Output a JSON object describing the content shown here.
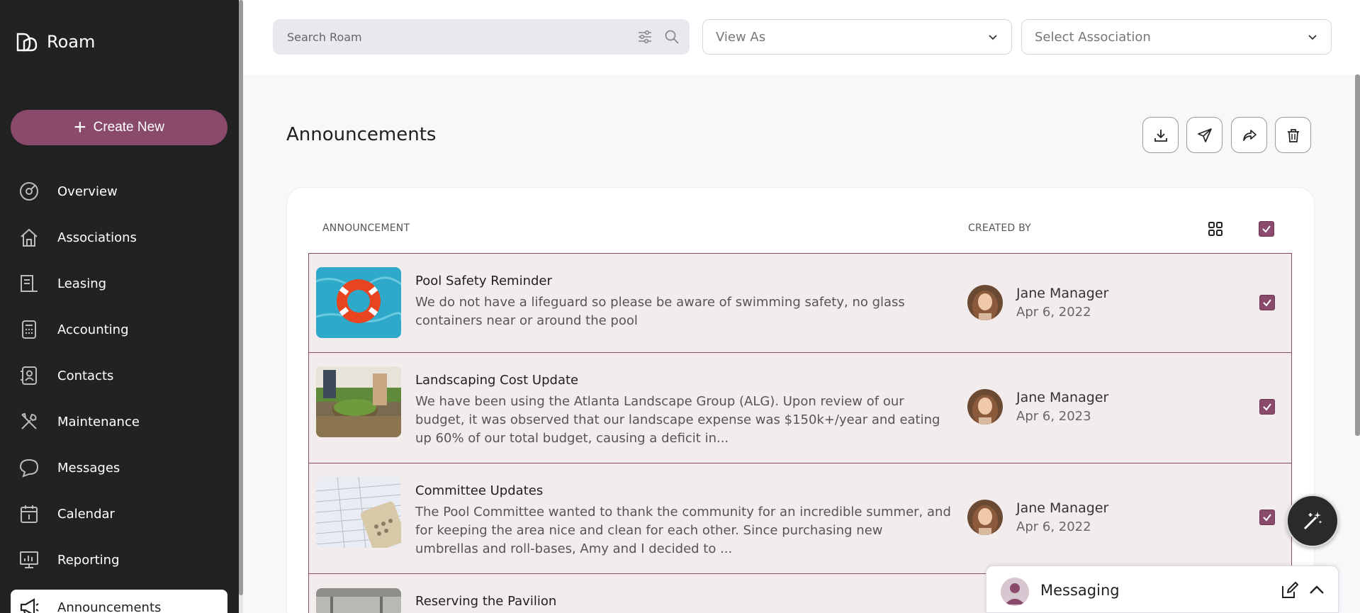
{
  "app": {
    "name": "Roam"
  },
  "sidebar": {
    "create_label": "Create New",
    "items": [
      {
        "label": "Overview",
        "icon": "gauge-icon"
      },
      {
        "label": "Associations",
        "icon": "home-icon"
      },
      {
        "label": "Leasing",
        "icon": "lease-icon"
      },
      {
        "label": "Accounting",
        "icon": "calculator-icon"
      },
      {
        "label": "Contacts",
        "icon": "contacts-icon"
      },
      {
        "label": "Maintenance",
        "icon": "tools-icon"
      },
      {
        "label": "Messages",
        "icon": "chat-icon"
      },
      {
        "label": "Calendar",
        "icon": "calendar-icon"
      },
      {
        "label": "Reporting",
        "icon": "monitor-chart-icon"
      },
      {
        "label": "Announcements",
        "icon": "megaphone-icon",
        "active": true
      }
    ]
  },
  "header": {
    "search_placeholder": "Search Roam",
    "view_as": "View As",
    "select_association": "Select Association"
  },
  "main": {
    "title": "Announcements",
    "columns": {
      "announcement": "ANNOUNCEMENT",
      "created_by": "CREATED BY"
    },
    "rows": [
      {
        "title": "Pool Safety Reminder",
        "desc_lines": [
          "We do not have a lifeguard so please be aware of swimming safety, no glass",
          "containers near or around the pool"
        ],
        "author": "Jane Manager",
        "date": "Apr 6, 2022",
        "checked": true
      },
      {
        "title": "Landscaping Cost Update",
        "desc_lines": [
          "We have been using the Atlanta Landscape Group (ALG). Upon review of our",
          "budget, it was observed that our landscape expense was $150k+/year and eating",
          "up 60% of our total budget, causing a deficit in..."
        ],
        "author": "Jane Manager",
        "date": "Apr 6, 2023",
        "checked": true
      },
      {
        "title": "Committee Updates",
        "desc_lines": [
          "The Pool Committee wanted to thank the community for an incredible summer, and",
          "for keeping the area nice and clean for each other. Since purchasing new",
          "umbrellas and roll-bases, Amy and I decided to ..."
        ],
        "author": "Jane Manager",
        "date": "Apr 6, 2022",
        "checked": true
      },
      {
        "title": "Reserving the Pavilion",
        "desc_lines": [],
        "author": "",
        "date": "",
        "checked": false
      }
    ]
  },
  "messaging": {
    "title": "Messaging"
  },
  "colors": {
    "brand": "#8a4a6b",
    "sidebar_bg": "#222222",
    "row_bg": "#f3eced"
  }
}
